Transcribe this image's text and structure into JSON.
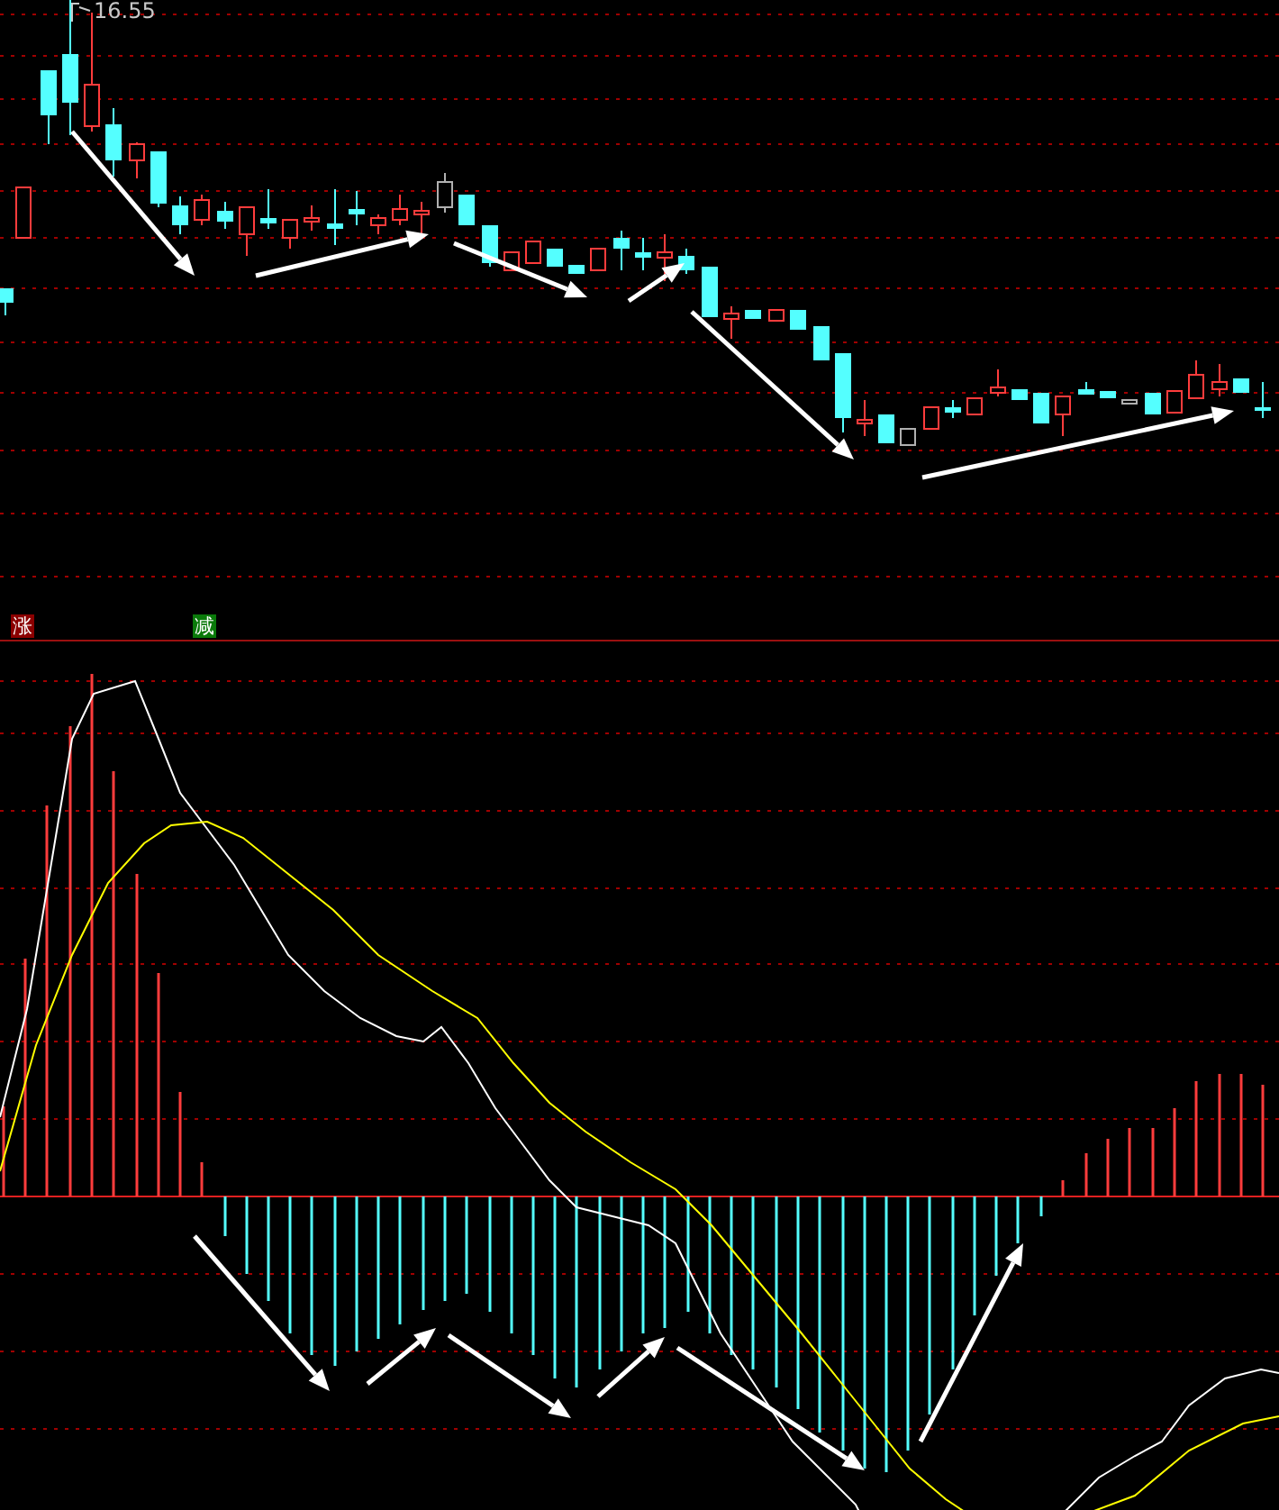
{
  "price_panel": {
    "high_label": "16.55"
  },
  "indicator_tags": [
    {
      "label": "涨",
      "color": "#8b0000"
    },
    {
      "label": "减",
      "color": "#0a7a0a"
    }
  ]
}
